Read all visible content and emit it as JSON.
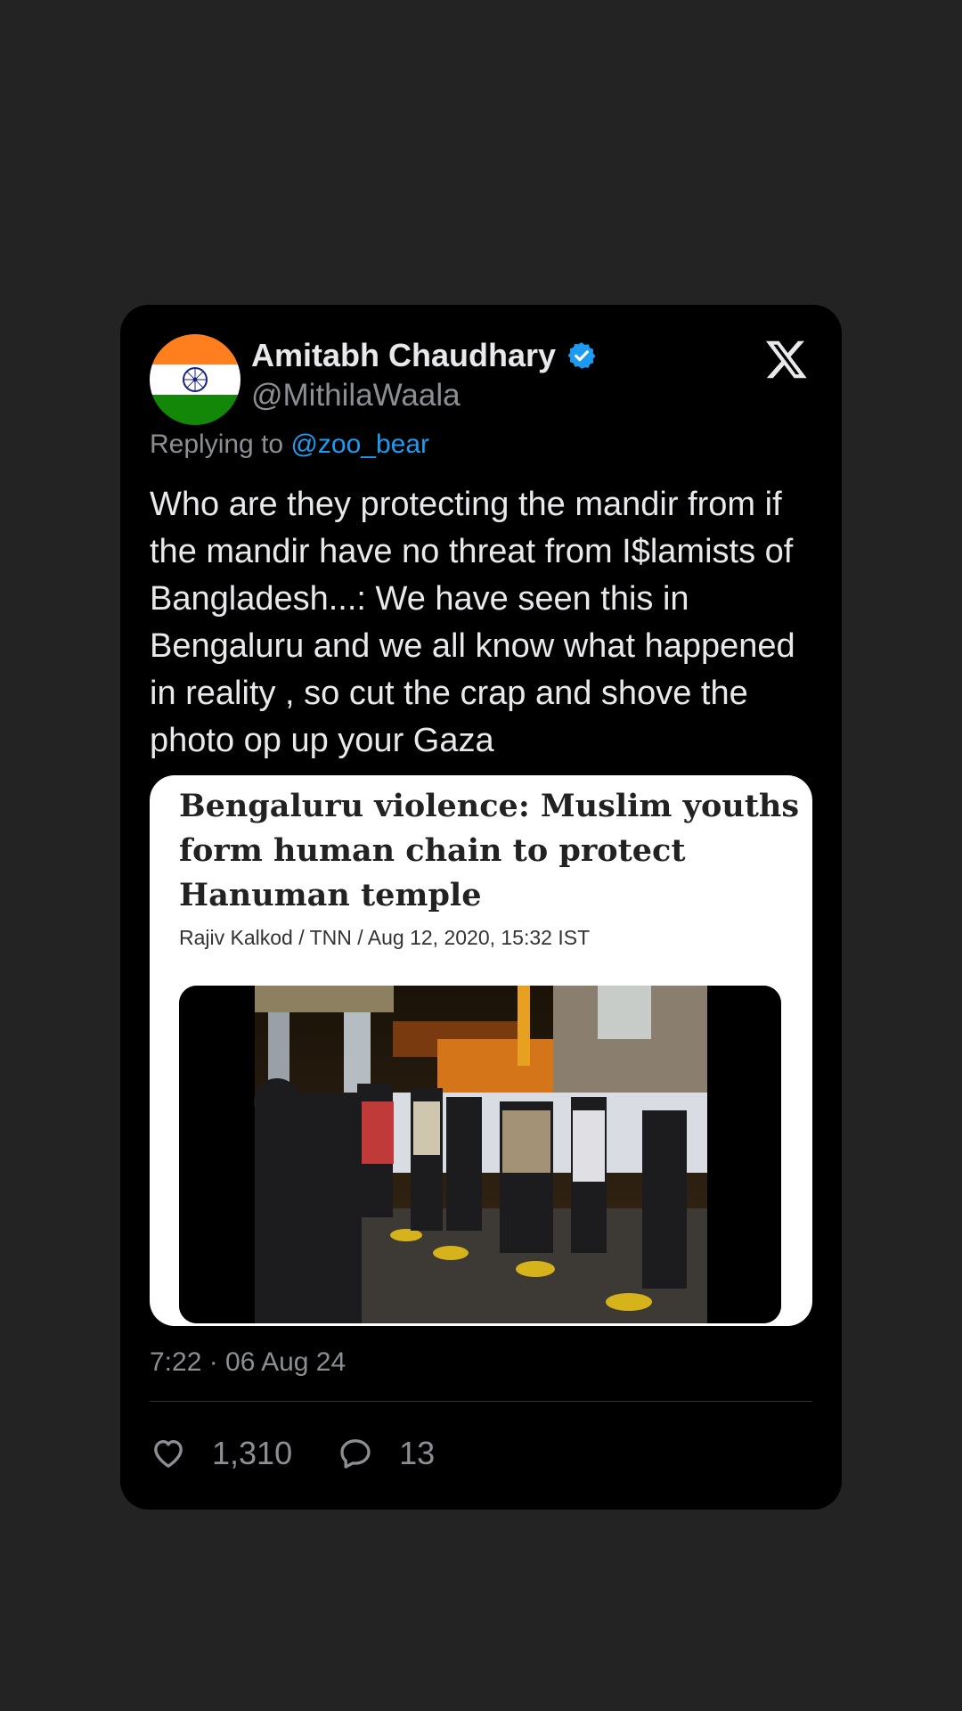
{
  "post": {
    "author_name": "Amitabh Chaudhary",
    "handle": "@MithilaWaala",
    "replying_prefix": "Replying to ",
    "replying_mention": "@zoo_bear",
    "text": "Who are they protecting the mandir from if the mandir have no threat from I$lamists of Bangladesh...: We have seen this in Bengaluru and we all know what happened in reality , so cut the crap and shove the photo op up your Gaza",
    "timestamp": "7:22 · 06 Aug 24",
    "likes": "1,310",
    "replies": "13"
  },
  "embed": {
    "headline": "Bengaluru violence: Muslim youths form human chain to protect Hanuman temple",
    "byline": "Rajiv Kalkod / TNN / Aug 12, 2020, 15:32 IST"
  },
  "icons": {
    "avatar": "india-flag-avatar",
    "verified": "verified-badge-icon",
    "logo": "x-logo-icon",
    "like": "heart-icon",
    "reply": "comment-icon"
  },
  "colors": {
    "background": "#232323",
    "card": "#000000",
    "accent": "#1d9bf0",
    "muted": "#8b8f94"
  }
}
